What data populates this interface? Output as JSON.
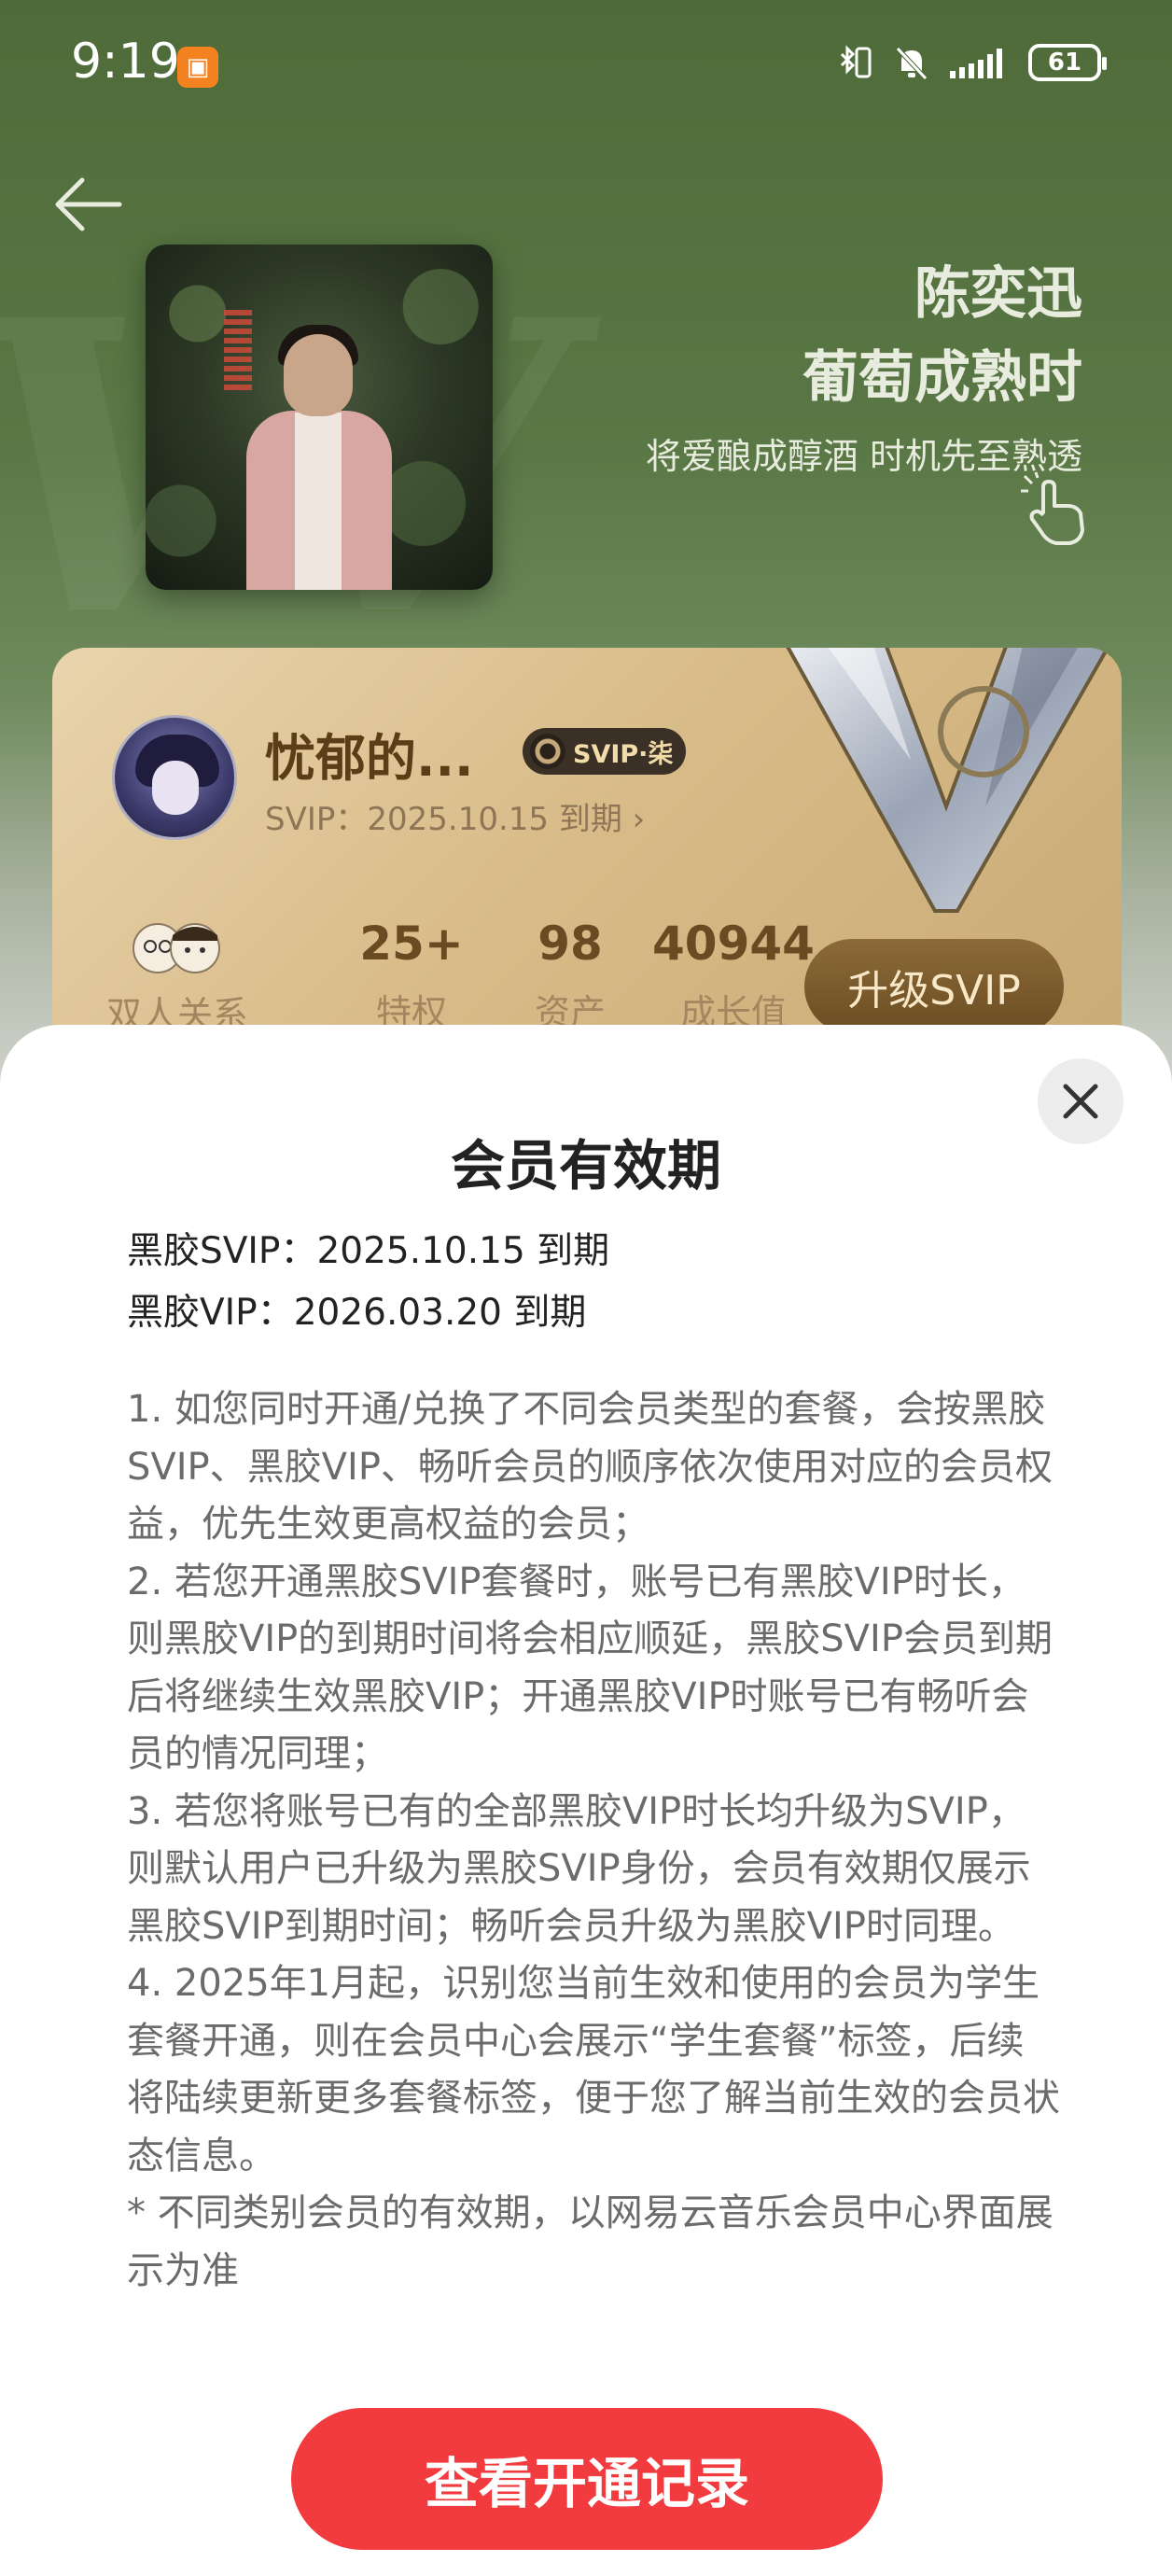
{
  "status_bar": {
    "time": "9:19",
    "battery": "61",
    "icons": [
      "notification-app-icon",
      "bluetooth-vibrate-icon",
      "mute-bell-icon",
      "signal-icon",
      "battery-icon"
    ]
  },
  "header": {
    "back_icon": "arrow-left-icon",
    "hero_title_line1": "陈奕迅",
    "hero_title_line2": "葡萄成熟时",
    "hero_subtitle": "将爱酿成醇酒 时机先至熟透"
  },
  "member_card": {
    "username": "忧郁的...",
    "badge_label": "SVIP·柒",
    "expire_text": "SVIP：2025.10.15 到期 ›",
    "stats": [
      {
        "value": "",
        "label": "双人关系"
      },
      {
        "value": "25+",
        "label": "特权"
      },
      {
        "value": "98",
        "label": "资产"
      },
      {
        "value": "40944",
        "label": "成长值"
      }
    ],
    "upgrade_button": "升级SVIP"
  },
  "sheet": {
    "title": "会员有效期",
    "validity_svip": "黑胶SVIP：2025.10.15 到期",
    "validity_vip": "黑胶VIP：2026.03.20 到期",
    "notes": [
      "1. 如您同时开通/兑换了不同会员类型的套餐，会按黑胶SVIP、黑胶VIP、畅听会员的顺序依次使用对应的会员权益，优先生效更高权益的会员；",
      "2. 若您开通黑胶SVIP套餐时，账号已有黑胶VIP时长，则黑胶VIP的到期时间将会相应顺延，黑胶SVIP会员到期后将继续生效黑胶VIP；开通黑胶VIP时账号已有畅听会员的情况同理；",
      "3. 若您将账号已有的全部黑胶VIP时长均升级为SVIP，则默认用户已升级为黑胶SVIP身份，会员有效期仅展示黑胶SVIP到期时间；畅听会员升级为黑胶VIP时同理。",
      "4. 2025年1月起，识别您当前生效和使用的会员为学生套餐开通，则在会员中心会展示“学生套餐”标签，后续将陆续更新更多套餐标签，便于您了解当前生效的会员状态信息。",
      "* 不同类别会员的有效期，以网易云音乐会员中心界面展示为准"
    ],
    "cta_button": "查看开通记录"
  }
}
